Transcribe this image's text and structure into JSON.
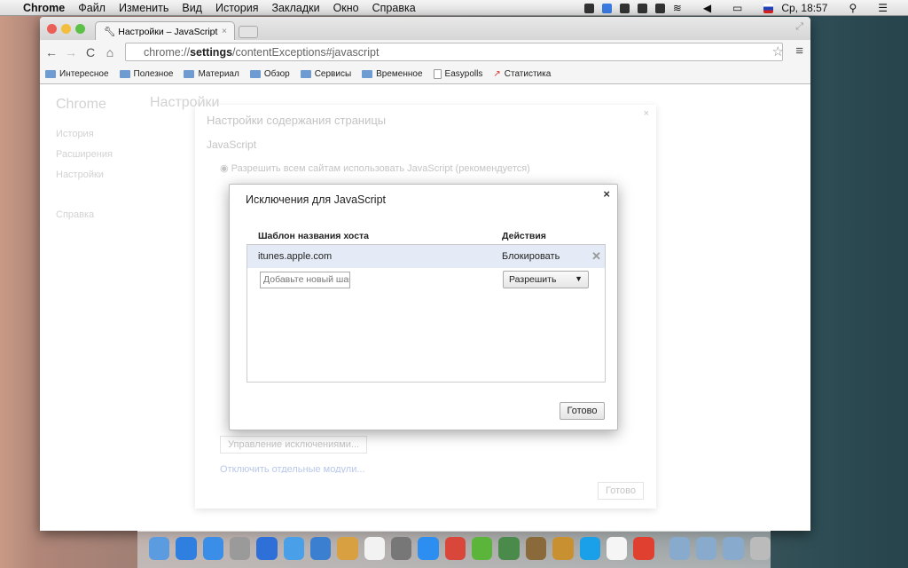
{
  "menubar": {
    "app": "Chrome",
    "items": [
      "Файл",
      "Изменить",
      "Вид",
      "История",
      "Закладки",
      "Окно",
      "Справка"
    ],
    "clock": "Ср, 18:57"
  },
  "browser": {
    "tab_title": "Настройки – JavaScript",
    "url_prefix": "chrome://",
    "url_bold": "settings",
    "url_rest": "/contentExceptions#javascript",
    "bookmarks": [
      "Интересное",
      "Полезное",
      "Материал",
      "Обзор",
      "Сервисы",
      "Временное",
      "Easypolls",
      "Статистика"
    ]
  },
  "settings_bg": {
    "brand": "Chrome",
    "nav": [
      "История",
      "Расширения",
      "Настройки",
      "Справка"
    ],
    "heading": "Настройки"
  },
  "content_dialog": {
    "title": "Настройки содержания страницы",
    "section": "JavaScript",
    "option_allow": "Разрешить всем сайтам использовать JavaScript (рекомендуется)",
    "manage_exceptions": "Управление исключениями...",
    "plugins_link": "Отключить отдельные модули...",
    "done": "Готово"
  },
  "exceptions_dialog": {
    "title": "Исключения для JavaScript",
    "col_host": "Шаблон названия хоста",
    "col_action": "Действия",
    "rows": [
      {
        "host": "itunes.apple.com",
        "action": "Блокировать"
      }
    ],
    "new_placeholder": "Добавьте новый шаблон",
    "new_action": "Разрешить",
    "done": "Готово"
  },
  "dock_colors": [
    "#5b9be0",
    "#2f7fe0",
    "#3a8ee8",
    "#9a9a9a",
    "#2f6fd8",
    "#4aa0e8",
    "#3b7fd0",
    "#d8a040",
    "#f2f2f2",
    "#777",
    "#2c8ef0",
    "#d8473a",
    "#5ab53a",
    "#4a8a4a",
    "#8a6a3a",
    "#c89030",
    "#1aa0e8",
    "#f5f5f5",
    "#e04030",
    "#88aacc",
    "#88aacc",
    "#88aacc",
    "#bbb"
  ]
}
